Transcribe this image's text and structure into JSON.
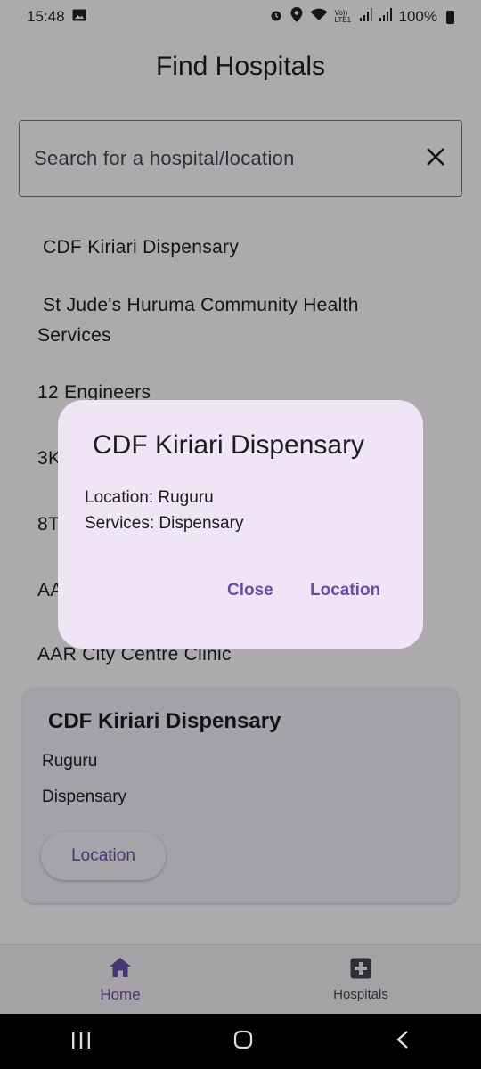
{
  "status_bar": {
    "time": "15:48",
    "battery": "100%",
    "icons": [
      "image-icon",
      "alarm-icon",
      "location-icon",
      "wifi-icon",
      "volte-icon",
      "signal-icon",
      "signal-icon-2",
      "battery-icon"
    ],
    "volte_label": "Vo)) LTE1"
  },
  "header": {
    "title": "Find Hospitals"
  },
  "search": {
    "placeholder": "Search for a hospital/location",
    "clear_icon": "close-icon"
  },
  "list": {
    "items": [
      "CDF Kiriari Dispensary",
      "St Jude's Huruma Community Health Services",
      "12 Engineers",
      "3K",
      "8T",
      "AA",
      "AAR City Centre Clinic"
    ]
  },
  "card": {
    "title": "CDF Kiriari Dispensary",
    "location": "Ruguru",
    "services": "Dispensary",
    "button_label": "Location"
  },
  "bottom_nav": {
    "items": [
      {
        "label": "Home",
        "icon": "home-icon",
        "selected": true
      },
      {
        "label": "Hospitals",
        "icon": "hospital-icon",
        "selected": false
      }
    ],
    "accent": "#6750a4"
  },
  "dialog": {
    "title": "CDF Kiriari Dispensary",
    "location_line": "Location: Ruguru",
    "services_line": "Services: Dispensary",
    "close_label": "Close",
    "location_label": "Location"
  },
  "system_nav": {
    "icons": [
      "recents-icon",
      "home-circle-icon",
      "back-icon"
    ]
  }
}
